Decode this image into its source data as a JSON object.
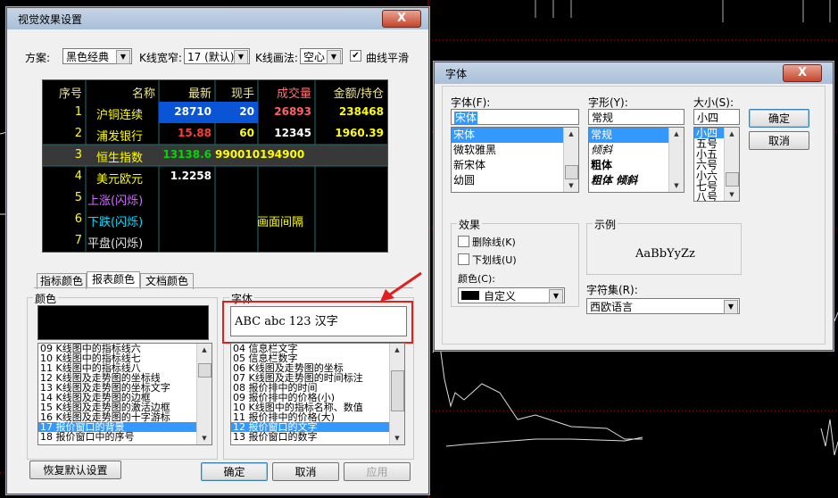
{
  "main_dialog": {
    "title": "视觉效果设置",
    "close": "X",
    "scheme_label": "方案:",
    "scheme_value": "黑色经典",
    "kwidth_label": "K线宽窄:",
    "kwidth_value": "17 (默认)",
    "kdraw_label": "K线画法:",
    "kdraw_value": "空心",
    "smooth_label": "曲线平滑",
    "smooth_checked": true,
    "table": {
      "headers": [
        "序号",
        "名称",
        "最新",
        "现手",
        "成交量",
        "金额/持仓"
      ],
      "rows": [
        {
          "idx": "1",
          "name": "沪铜连续",
          "latest": "28710",
          "lot": "20",
          "vol": "26893",
          "amt": "238468"
        },
        {
          "idx": "2",
          "name": "浦发银行",
          "latest": "15.88",
          "lot": "60",
          "vol": "12345",
          "amt": "1960.39"
        },
        {
          "idx": "3",
          "name": "恒生指数",
          "latest": "13138.6",
          "lot": "990010194900",
          "vol": "",
          "amt": ""
        },
        {
          "idx": "4",
          "name": "美元欧元",
          "latest": "1.2258",
          "lot": "",
          "vol": "",
          "amt": ""
        },
        {
          "idx": "5",
          "name": "上涨(闪烁)",
          "latest": "",
          "lot": "",
          "vol": "",
          "amt": ""
        },
        {
          "idx": "6",
          "name": "下跌(闪烁)",
          "latest": "",
          "lot": "",
          "vol": "",
          "amt": ""
        },
        {
          "idx": "7",
          "name": "平盘(闪烁)",
          "latest": "",
          "lot": "",
          "vol": "",
          "amt": ""
        }
      ],
      "gap_text": "画面间隔"
    },
    "tabs": [
      "指标颜色",
      "报表颜色",
      "文档颜色"
    ],
    "color_group": "颜色",
    "font_group": "字体",
    "font_preview": "ABC abc 123 汉字",
    "color_list": [
      "09 K线图中的指标线六",
      "10 K线图中的指标线七",
      "11 K线图中的指标线八",
      "12 K线图及走势图的坐标线",
      "13 K线图及走势图的坐标文字",
      "14 K线图及走势图的边框",
      "15 K线图及走势图的激活边框",
      "16 K线图及走势图的十字游标",
      "17 报价窗口的背景",
      "18 报价窗口中的序号"
    ],
    "font_list": [
      "04 信息栏文字",
      "05 信息栏数字",
      "06 K线图及走势图的坐标",
      "07 K线图及走势图的时间标注",
      "08 报价排中的时间",
      "09 报价排中的价格(小)",
      "10 K线图中的指标名称、数值",
      "11 报价排中的价格(大)",
      "12 报价窗口的文字",
      "13 报价窗口的数字"
    ],
    "restore_btn": "恢复默认设置",
    "ok_btn": "确定",
    "cancel_btn": "取消",
    "apply_btn": "应用"
  },
  "font_dialog": {
    "title": "字体",
    "close": "X",
    "font_label": "字体(F):",
    "font_value": "宋体",
    "font_options": [
      "宋体",
      "微软雅黑",
      "新宋体",
      "幼圆"
    ],
    "style_label": "字形(Y):",
    "style_value": "常规",
    "style_options": [
      "常规",
      "倾斜",
      "粗体",
      "粗体 倾斜"
    ],
    "size_label": "大小(S):",
    "size_value": "小四",
    "size_options": [
      "小四",
      "五号",
      "小五",
      "六号",
      "小六",
      "七号",
      "八号"
    ],
    "ok_btn": "确定",
    "cancel_btn": "取消",
    "effects_label": "效果",
    "strike_label": "删除线(K)",
    "underline_label": "下划线(U)",
    "color_label": "颜色(C):",
    "color_value": "自定义",
    "sample_label": "示例",
    "sample_text": "AaBbYyZz",
    "charset_label": "字符集(R):",
    "charset_value": "西欧语言"
  },
  "colors": {
    "rise": "#ff3c3c",
    "fall": "#00d800",
    "yellow": "#ffff00",
    "cyan": "#00ffff",
    "highlight": "#3399ff",
    "annotation": "#e02020"
  }
}
